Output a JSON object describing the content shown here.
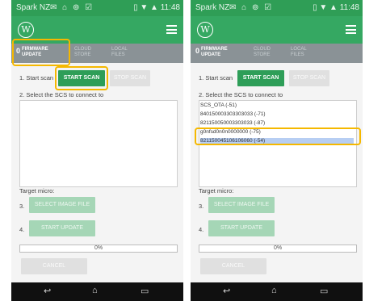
{
  "screens": [
    {
      "status": {
        "carrier": "Spark NZ",
        "icons": "✉ ⌂ ⊚ ☑",
        "right": "▯ ▼ ▲ 11:48"
      },
      "logo_glyph": "W",
      "tabs": {
        "num": "0",
        "firmware": "FIRMWARE UPDATE",
        "cloud": "CLOUD STORE",
        "local": "LOCAL FILES"
      },
      "step1": "1. Start scan",
      "start_scan": "START SCAN",
      "stop_scan": "STOP SCAN",
      "step2": "2. Select the SCS to connect to",
      "devices": [],
      "target_micro": "Target micro:",
      "step3": "3.",
      "select_image": "SELECT IMAGE FILE",
      "step4": "4.",
      "start_update": "START UPDATE",
      "progress_text": "0%",
      "progress": 0,
      "cancel": "CANCEL"
    },
    {
      "status": {
        "carrier": "Spark NZ",
        "icons": "✉ ⌂ ⊚ ☑",
        "right": "▯ ▼ ▲ 11:48"
      },
      "logo_glyph": "W",
      "tabs": {
        "num": "0",
        "firmware": "FIRMWARE UPDATE",
        "cloud": "CLOUD STORE",
        "local": "LOCAL FILES"
      },
      "step1": "1. Start scan",
      "start_scan": "START SCAN",
      "stop_scan": "STOP SCAN",
      "step2": "2. Select the SCS to connect to",
      "devices": [
        "SCS_OTA (-51)",
        "840150003303303033 (-71)",
        "821150050003303033 (-87)",
        "g0nfsd0n0n0000000 (-75)",
        "821150045106106060 (-54)"
      ],
      "selected_device": 4,
      "target_micro": "Target micro:",
      "step3": "3.",
      "select_image": "SELECT IMAGE FILE",
      "step4": "4.",
      "start_update": "START UPDATE",
      "progress_text": "0%",
      "progress": 0,
      "cancel": "CANCEL"
    }
  ],
  "colors": {
    "accent": "#35a862",
    "highlight": "#f5b800",
    "tabs_bg": "#8a9296",
    "selected_row": "#b7cef3"
  }
}
